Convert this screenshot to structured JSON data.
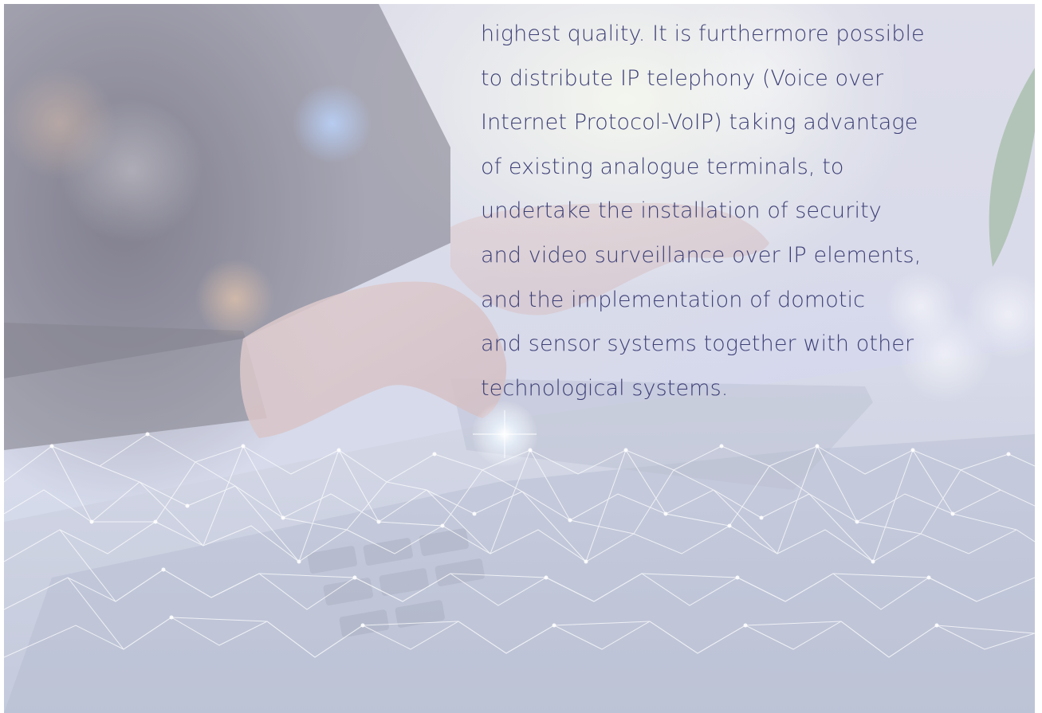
{
  "body_text": {
    "lines": [
      "highest quality. It is furthermore possible",
      "to distribute IP telephony (Voice over",
      "Internet Protocol-VoIP) taking advantage",
      "of existing analogue terminals, to",
      "undertake the installation of security",
      "and video surveillance over IP elements,",
      "and the implementation of domotic",
      "and sensor systems together with other",
      "technological systems."
    ]
  },
  "colors": {
    "text": "#3d3f76",
    "network_lines": "#ffffff"
  },
  "background_image": {
    "icon": "laptop-hands-network-photo"
  }
}
